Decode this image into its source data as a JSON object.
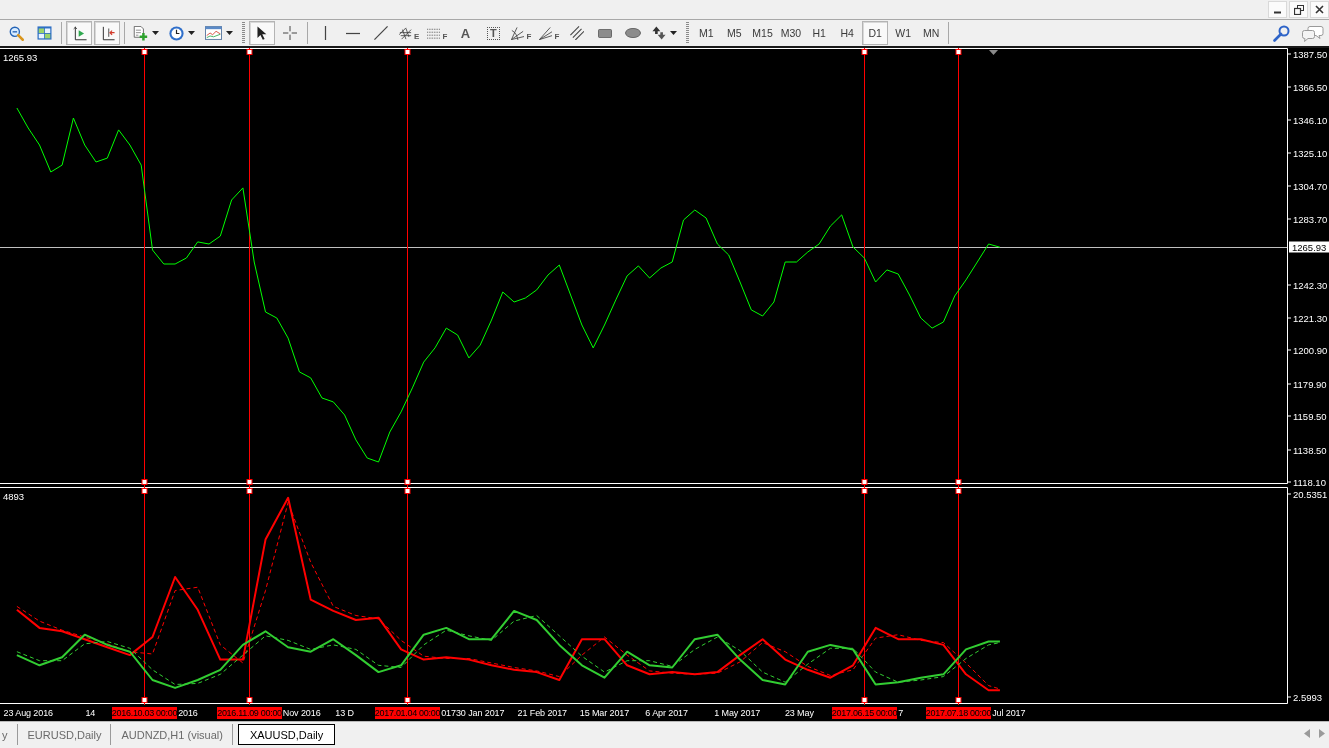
{
  "window_controls": [
    {
      "kind": "minimize"
    },
    {
      "kind": "restore"
    },
    {
      "kind": "close"
    }
  ],
  "toolbar": {
    "chart_tools": [
      [
        {
          "kind": "zoom-out",
          "pressed": false,
          "dropdown": false
        },
        {
          "kind": "tile",
          "pressed": false,
          "dropdown": false
        }
      ],
      [
        {
          "kind": "autoscroll",
          "pressed": true,
          "dropdown": false
        },
        {
          "kind": "chart-shift",
          "pressed": true,
          "dropdown": false
        }
      ],
      [
        {
          "kind": "indicators",
          "pressed": false,
          "dropdown": true
        },
        {
          "kind": "periods",
          "pressed": false,
          "dropdown": true
        },
        {
          "kind": "templates",
          "pressed": false,
          "dropdown": true
        }
      ]
    ],
    "line_studies": [
      [
        {
          "kind": "cursor",
          "pressed": true,
          "dropdown": false
        },
        {
          "kind": "crosshair",
          "pressed": false,
          "dropdown": false
        }
      ],
      [
        {
          "kind": "vline",
          "pressed": false,
          "dropdown": false
        },
        {
          "kind": "hline",
          "pressed": false,
          "dropdown": false
        },
        {
          "kind": "trendline",
          "pressed": false,
          "dropdown": false
        },
        {
          "kind": "channel",
          "pressed": false,
          "dropdown": false,
          "badge": "E"
        },
        {
          "kind": "fibo",
          "pressed": false,
          "dropdown": false,
          "badge": "F"
        },
        {
          "kind": "text",
          "pressed": false,
          "dropdown": false,
          "glyph": "A"
        },
        {
          "kind": "label",
          "pressed": false,
          "dropdown": false,
          "glyph": "T"
        },
        {
          "kind": "fan",
          "pressed": false,
          "dropdown": false,
          "badge": "F"
        },
        {
          "kind": "fibo-fan",
          "pressed": false,
          "dropdown": false,
          "badge": "F"
        },
        {
          "kind": "parallel",
          "pressed": false,
          "dropdown": false
        },
        {
          "kind": "rectangle",
          "pressed": false,
          "dropdown": false
        },
        {
          "kind": "ellipse",
          "pressed": false,
          "dropdown": false
        },
        {
          "kind": "arrows",
          "pressed": false,
          "dropdown": true
        }
      ]
    ],
    "timeframes": [
      {
        "label": "M1",
        "selected": false
      },
      {
        "label": "M5",
        "selected": false
      },
      {
        "label": "M15",
        "selected": false
      },
      {
        "label": "M30",
        "selected": false
      },
      {
        "label": "H1",
        "selected": false
      },
      {
        "label": "H4",
        "selected": false
      },
      {
        "label": "D1",
        "selected": true
      },
      {
        "label": "W1",
        "selected": false
      },
      {
        "label": "MN",
        "selected": false
      }
    ],
    "right_tools": [
      {
        "kind": "search"
      },
      {
        "kind": "chat"
      }
    ]
  },
  "chart": {
    "vertical_lines_selected": true,
    "time_axis_tails": [
      "2016",
      "Nov 2016",
      "017",
      "7",
      "Jul 2017"
    ],
    "chart_data": [
      {
        "type": "line",
        "color": "#00ff00",
        "tick_labels": "y",
        "xlim": [
          "2016-08-13",
          "2017-11-12"
        ],
        "ylim": [
          1114.95,
          1391.28
        ],
        "yticks": [
          {
            "value": 1387.5,
            "label": "1387.50"
          },
          {
            "value": 1366.5,
            "label": "1366.50"
          },
          {
            "value": 1346.1,
            "label": "1346.10"
          },
          {
            "value": 1325.1,
            "label": "1325.10"
          },
          {
            "value": 1304.7,
            "label": "1304.70"
          },
          {
            "value": 1283.7,
            "label": "1283.70"
          },
          {
            "value": 1242.3,
            "label": "1242.30"
          },
          {
            "value": 1221.3,
            "label": "1221.30"
          },
          {
            "value": 1200.9,
            "label": "1200.90"
          },
          {
            "value": 1179.9,
            "label": "1179.90"
          },
          {
            "value": 1159.5,
            "label": "1159.50"
          },
          {
            "value": 1138.5,
            "label": "1138.50"
          },
          {
            "value": 1118.1,
            "label": "1118.10"
          }
        ],
        "x": [
          "2016-08-19",
          "2016-08-23",
          "2016-08-27",
          "2016-08-31",
          "2016-09-04",
          "2016-09-08",
          "2016-09-12",
          "2016-09-16",
          "2016-09-20",
          "2016-09-24",
          "2016-09-28",
          "2016-10-02",
          "2016-10-06",
          "2016-10-10",
          "2016-10-14",
          "2016-10-18",
          "2016-10-22",
          "2016-10-26",
          "2016-10-30",
          "2016-11-03",
          "2016-11-07",
          "2016-11-11",
          "2016-11-15",
          "2016-11-19",
          "2016-11-23",
          "2016-11-27",
          "2016-12-01",
          "2016-12-05",
          "2016-12-09",
          "2016-12-13",
          "2016-12-17",
          "2016-12-21",
          "2016-12-25",
          "2016-12-29",
          "2017-01-02",
          "2017-01-06",
          "2017-01-10",
          "2017-01-14",
          "2017-01-18",
          "2017-01-22",
          "2017-01-26",
          "2017-01-30",
          "2017-02-03",
          "2017-02-07",
          "2017-02-11",
          "2017-02-15",
          "2017-02-19",
          "2017-02-23",
          "2017-02-27",
          "2017-03-03",
          "2017-03-07",
          "2017-03-11",
          "2017-03-15",
          "2017-03-19",
          "2017-03-23",
          "2017-03-27",
          "2017-03-31",
          "2017-04-04",
          "2017-04-08",
          "2017-04-12",
          "2017-04-16",
          "2017-04-20",
          "2017-04-24",
          "2017-04-28",
          "2017-05-02",
          "2017-05-06",
          "2017-05-10",
          "2017-05-14",
          "2017-05-18",
          "2017-05-22",
          "2017-05-26",
          "2017-05-30",
          "2017-06-03",
          "2017-06-07",
          "2017-06-11",
          "2017-06-15",
          "2017-06-19",
          "2017-06-23",
          "2017-06-27",
          "2017-07-01",
          "2017-07-05",
          "2017-07-09",
          "2017-07-13",
          "2017-07-17",
          "2017-07-21",
          "2017-07-25",
          "2017-07-29",
          "2017-08-02"
        ],
        "values": [
          1353.5,
          1340.9,
          1330.2,
          1313.2,
          1317.6,
          1347.2,
          1330.2,
          1319.5,
          1322.0,
          1339.7,
          1330.2,
          1317.6,
          1264.1,
          1255.3,
          1255.3,
          1259.1,
          1269.2,
          1267.9,
          1272.9,
          1295.6,
          1303.2,
          1256.6,
          1225.1,
          1221.3,
          1208.7,
          1187.4,
          1183.6,
          1171.0,
          1168.5,
          1160.3,
          1144.6,
          1133.2,
          1130.7,
          1149.6,
          1162.2,
          1177.3,
          1193.6,
          1202.5,
          1215.0,
          1210.6,
          1196.2,
          1204.3,
          1220.1,
          1237.7,
          1231.4,
          1233.9,
          1239.0,
          1248.4,
          1254.7,
          1235.8,
          1216.9,
          1202.5,
          1216.9,
          1232.7,
          1247.8,
          1254.1,
          1246.5,
          1252.8,
          1256.6,
          1283.0,
          1289.3,
          1284.3,
          1267.9,
          1261.0,
          1244.0,
          1226.4,
          1222.6,
          1231.4,
          1256.6,
          1256.6,
          1262.9,
          1267.9,
          1279.2,
          1286.2,
          1266.0,
          1259.1,
          1244.0,
          1251.6,
          1249.0,
          1235.8,
          1221.3,
          1215.0,
          1218.8,
          1235.2,
          1245.3,
          1256.6,
          1267.9,
          1265.9
        ],
        "ref_lines": [
          {
            "axis": "y",
            "value": 1265.93,
            "label": "1265.93",
            "color": "#c0c0c0"
          },
          {
            "axis": "x",
            "value": "2016-10-03",
            "color": "#ff0000"
          },
          {
            "axis": "x",
            "value": "2016-11-09",
            "color": "#ff0000"
          },
          {
            "axis": "x",
            "value": "2017-01-04",
            "color": "#ff0000"
          },
          {
            "axis": "x",
            "value": "2017-06-15",
            "color": "#ff0000"
          },
          {
            "axis": "x",
            "value": "2017-07-18",
            "color": "#ff0000"
          }
        ],
        "annotations": [
          "1265.93"
        ]
      },
      {
        "type": "line",
        "xlim": [
          "2016-08-13",
          "2017-11-12"
        ],
        "ylim": [
          1.89,
          21.15
        ],
        "yticks": [
          20.5351,
          2.5993
        ],
        "xticks": [
          {
            "value": "2016-08-23",
            "label": "23 Aug 2016"
          },
          {
            "value": "2016-09-14",
            "label": "14"
          },
          {
            "value": "2016-12-13",
            "label": "13 D"
          },
          {
            "value": "2017-01-30",
            "label": "30 Jan 2017"
          },
          {
            "value": "2017-02-21",
            "label": "21 Feb 2017"
          },
          {
            "value": "2017-03-15",
            "label": "15 Mar 2017"
          },
          {
            "value": "2017-04-06",
            "label": "6 Apr 2017"
          },
          {
            "value": "2017-05-01",
            "label": "1 May 2017"
          },
          {
            "value": "2017-05-23",
            "label": "23 May"
          }
        ],
        "x": [
          "2016-08-19",
          "2016-08-27",
          "2016-09-04",
          "2016-09-12",
          "2016-09-20",
          "2016-09-28",
          "2016-10-06",
          "2016-10-14",
          "2016-10-22",
          "2016-10-30",
          "2016-11-07",
          "2016-11-15",
          "2016-11-23",
          "2016-12-01",
          "2016-12-09",
          "2016-12-17",
          "2016-12-25",
          "2017-01-02",
          "2017-01-10",
          "2017-01-18",
          "2017-01-26",
          "2017-02-03",
          "2017-02-11",
          "2017-02-19",
          "2017-02-27",
          "2017-03-07",
          "2017-03-15",
          "2017-03-23",
          "2017-03-31",
          "2017-04-08",
          "2017-04-16",
          "2017-04-24",
          "2017-05-02",
          "2017-05-10",
          "2017-05-18",
          "2017-05-26",
          "2017-06-03",
          "2017-06-11",
          "2017-06-19",
          "2017-06-27",
          "2017-07-05",
          "2017-07-13",
          "2017-07-21",
          "2017-07-29",
          "2017-08-02"
        ],
        "series": [
          {
            "color": "#ff0000",
            "line_style": "solid",
            "values": [
              10.3,
              8.7,
              8.4,
              7.7,
              7.0,
              6.3,
              7.9,
              13.2,
              10.3,
              5.9,
              5.9,
              16.5,
              20.2,
              11.2,
              10.2,
              9.4,
              9.6,
              6.8,
              5.9,
              6.1,
              5.9,
              5.4,
              5.0,
              4.8,
              4.1,
              7.7,
              7.7,
              5.4,
              4.6,
              4.8,
              4.6,
              4.8,
              6.3,
              7.7,
              5.9,
              5.0,
              4.3,
              5.4,
              8.7,
              7.7,
              7.7,
              7.2,
              4.6,
              3.2,
              3.2
            ]
          },
          {
            "color": "#ff0000",
            "line_style": "dashed",
            "values": [
              10.6,
              9.3,
              8.5,
              7.9,
              7.3,
              6.6,
              6.4,
              12.0,
              12.3,
              7.2,
              5.6,
              12.0,
              19.8,
              14.5,
              10.6,
              9.8,
              9.5,
              7.6,
              6.2,
              6.0,
              6.0,
              5.6,
              5.2,
              4.9,
              4.4,
              6.3,
              7.9,
              6.3,
              4.9,
              4.7,
              4.6,
              4.7,
              5.7,
              7.4,
              6.6,
              5.3,
              4.5,
              5.0,
              7.8,
              8.1,
              7.6,
              7.4,
              5.6,
              3.6,
              3.3
            ]
          },
          {
            "color": "#32cd32",
            "line_style": "solid",
            "values": [
              6.3,
              5.4,
              6.1,
              8.1,
              7.2,
              6.6,
              4.1,
              3.4,
              4.1,
              5.0,
              7.2,
              8.4,
              7.0,
              6.6,
              7.7,
              6.3,
              4.8,
              5.4,
              8.1,
              8.7,
              7.7,
              7.7,
              10.2,
              9.4,
              7.2,
              5.4,
              4.3,
              6.6,
              5.4,
              5.2,
              7.7,
              8.1,
              5.9,
              4.1,
              3.7,
              6.6,
              7.2,
              6.8,
              3.7,
              3.9,
              4.3,
              4.6,
              6.8,
              7.5,
              7.5
            ]
          },
          {
            "color": "#32cd32",
            "line_style": "dashed",
            "values": [
              6.6,
              5.8,
              5.8,
              7.3,
              7.5,
              6.9,
              5.0,
              3.7,
              3.8,
              4.6,
              6.3,
              8.0,
              7.6,
              6.8,
              7.2,
              6.8,
              5.4,
              5.2,
              7.2,
              8.5,
              8.0,
              7.6,
              9.3,
              9.8,
              8.0,
              6.2,
              4.8,
              5.8,
              5.8,
              5.3,
              6.8,
              7.9,
              6.7,
              4.8,
              3.9,
              5.5,
              6.9,
              6.9,
              4.8,
              3.9,
              4.1,
              4.4,
              6.0,
              7.2,
              7.4
            ]
          }
        ],
        "ref_lines": [
          {
            "axis": "x",
            "value": "2016-10-03",
            "label": "2016.10.03 00:00",
            "color": "#ff0000"
          },
          {
            "axis": "x",
            "value": "2016-11-09",
            "label": "2016.11.09 00:00",
            "color": "#ff0000"
          },
          {
            "axis": "x",
            "value": "2017-01-04",
            "label": "2017.01.04 00:00",
            "color": "#ff0000"
          },
          {
            "axis": "x",
            "value": "2017-06-15",
            "label": "2017.06.15 00:00",
            "color": "#ff0000"
          },
          {
            "axis": "x",
            "value": "2017-07-18",
            "label": "2017.07.18 00:00",
            "color": "#ff0000"
          }
        ],
        "annotations": [
          "4893"
        ]
      }
    ]
  },
  "tabs": [
    {
      "label": "y",
      "selected": false
    },
    {
      "label": "EURUSD,Daily",
      "selected": false
    },
    {
      "label": "AUDNZD,H1 (visual)",
      "selected": false
    },
    {
      "label": "XAUUSD,Daily",
      "selected": true
    }
  ],
  "tab_scroll": [
    {
      "kind": "left"
    },
    {
      "kind": "right"
    }
  ]
}
